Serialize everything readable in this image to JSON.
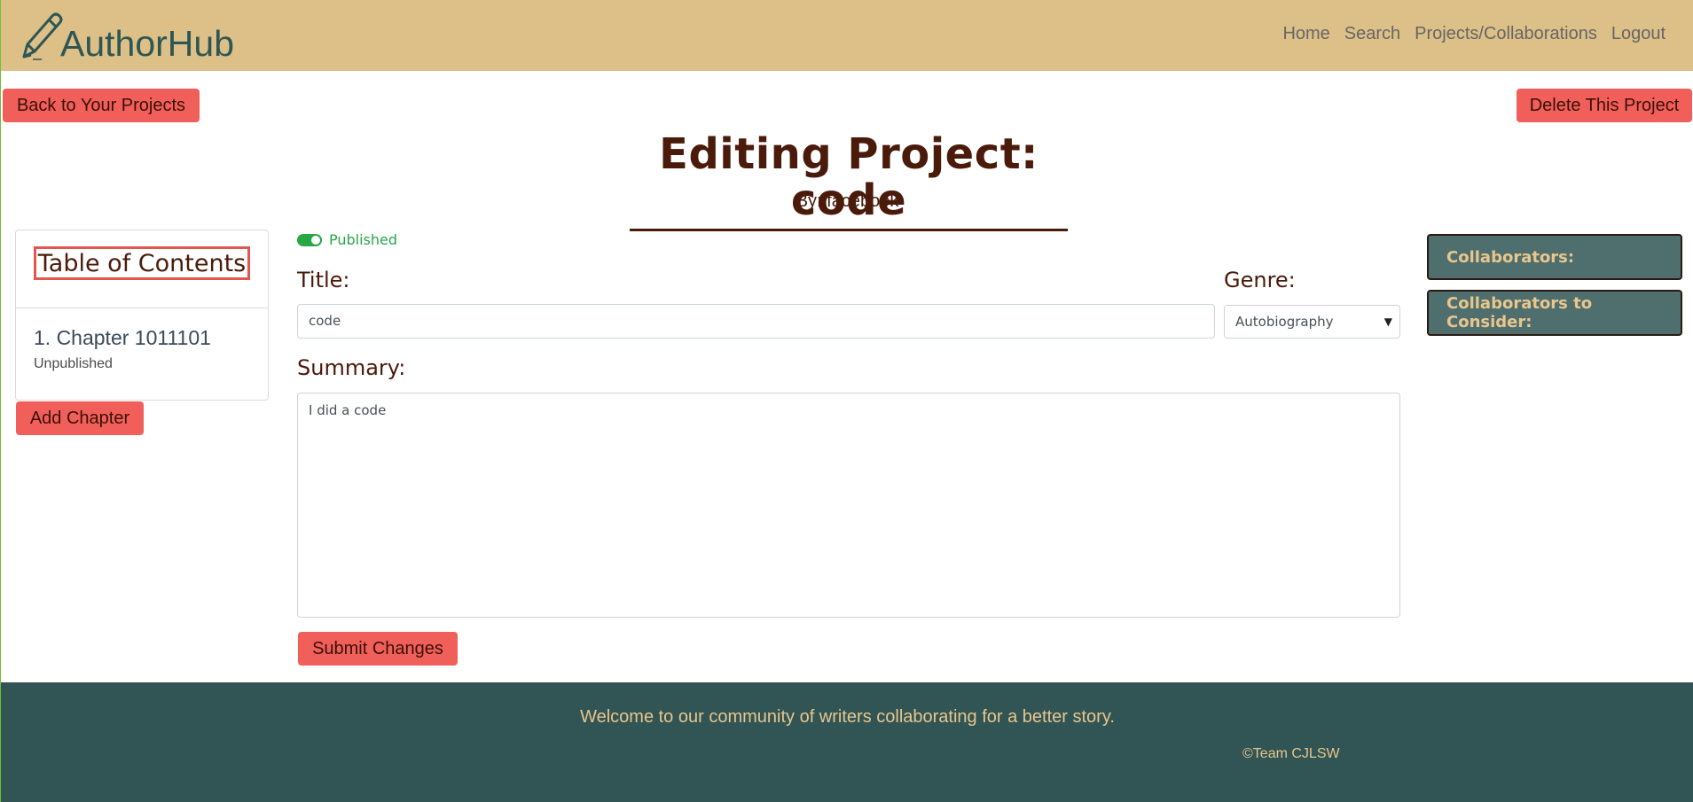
{
  "brand": {
    "name": "AuthorHub",
    "icon": "pencil-icon"
  },
  "nav": {
    "items": [
      "Home",
      "Search",
      "Projects/Collaborations",
      "Logout"
    ]
  },
  "actions": {
    "back": "Back to Your Projects",
    "delete": "Delete This Project"
  },
  "project": {
    "heading": "Editing Project: code",
    "byline": "By: facebook"
  },
  "toc": {
    "title": "Table of Contents",
    "chapters": [
      {
        "label": "1. Chapter 1011101",
        "status": "Unpublished"
      }
    ],
    "add_label": "Add Chapter"
  },
  "form": {
    "published_label": "Published",
    "published": true,
    "title_label": "Title:",
    "title_value": "code",
    "genre_label": "Genre:",
    "genre_value": "Autobiography",
    "summary_label": "Summary:",
    "summary_value": "I did a code",
    "submit_label": "Submit Changes"
  },
  "collaborators": {
    "current": "Collaborators:",
    "consider": "Collaborators to Consider:"
  },
  "footer": {
    "message": "Welcome to our community of writers collaborating for a better story.",
    "copyright": "©Team CJLSW"
  },
  "colors": {
    "header_bg": "#dcc088",
    "accent_button": "#f15f5a",
    "title_text": "#4a1a0b",
    "footer_bg": "#315454",
    "footer_text": "#e8c68c",
    "collab_bg": "#4f6e6e",
    "toggle_on": "#28a745"
  }
}
